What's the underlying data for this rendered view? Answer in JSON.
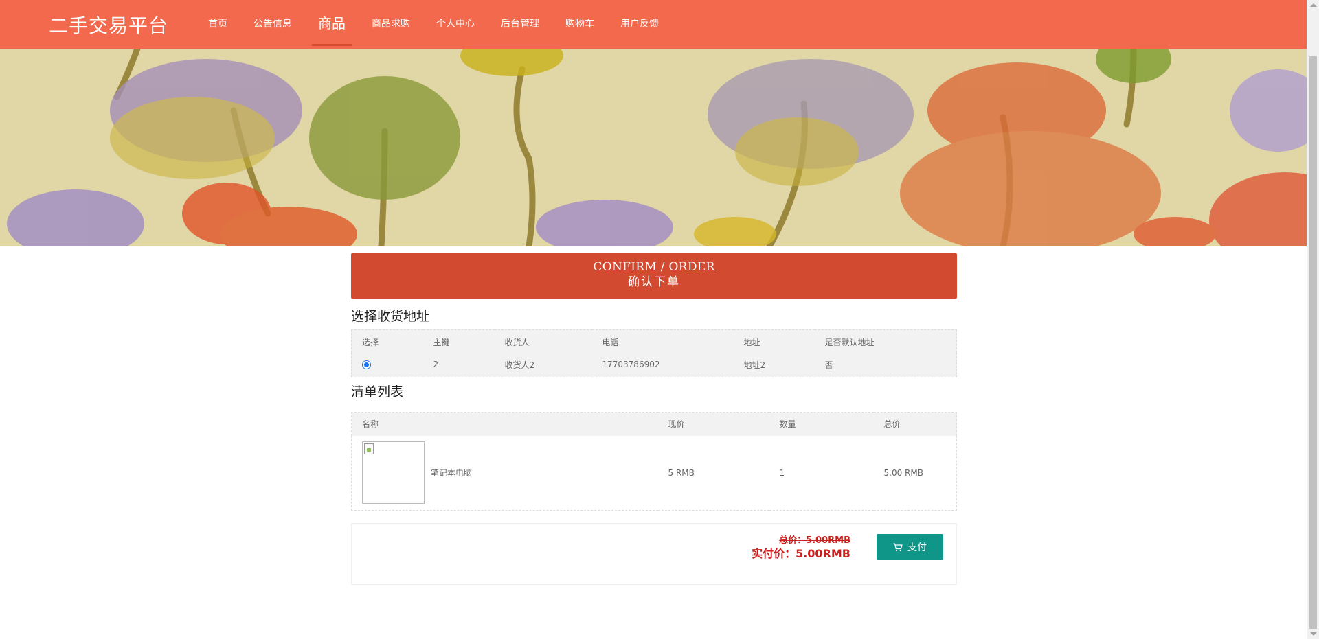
{
  "header": {
    "brand": "二手交易平台",
    "nav": [
      {
        "label": "首页",
        "active": false
      },
      {
        "label": "公告信息",
        "active": false
      },
      {
        "label": "商品",
        "active": true
      },
      {
        "label": "商品求购",
        "active": false
      },
      {
        "label": "个人中心",
        "active": false
      },
      {
        "label": "后台管理",
        "active": false
      },
      {
        "label": "购物车",
        "active": false
      },
      {
        "label": "用户反馈",
        "active": false
      }
    ]
  },
  "confirm": {
    "title": "CONFIRM / ORDER",
    "subtitle": "确认下单"
  },
  "address_section": {
    "title": "选择收货地址",
    "columns": [
      "选择",
      "主键",
      "收货人",
      "电话",
      "地址",
      "是否默认地址"
    ],
    "rows": [
      {
        "selected": true,
        "id": "2",
        "receiver": "收货人2",
        "phone": "17703786902",
        "address": "地址2",
        "is_default": "否"
      }
    ]
  },
  "list_section": {
    "title": "清单列表",
    "columns": [
      "名称",
      "现价",
      "数量",
      "总价"
    ],
    "rows": [
      {
        "name": "笔记本电脑",
        "price": "5 RMB",
        "quantity": "1",
        "total": "5.00 RMB"
      }
    ]
  },
  "payment": {
    "total_label": "总价：5.00RMB",
    "actual_label": "实付价：5.00RMB",
    "pay_button": "支付"
  },
  "colors": {
    "header_bg": "#f2694e",
    "confirm_bg": "#d24a30",
    "pay_button_bg": "#0f9688",
    "price_text": "#cc1f1f",
    "banner_bg": "#e1d6a6"
  },
  "icons": {
    "pay_button_icon": "cart-icon"
  }
}
